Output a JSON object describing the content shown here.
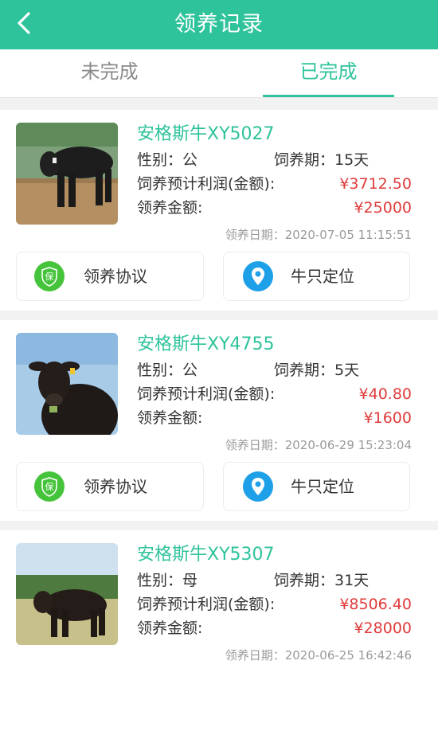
{
  "header": {
    "title": "领养记录"
  },
  "tabs": [
    {
      "label": "未完成",
      "active": false
    },
    {
      "label": "已完成",
      "active": true
    }
  ],
  "labels": {
    "gender": "性别",
    "period": "饲养期",
    "profit": "饲养预计利润(金额):",
    "amount": "领养金额:",
    "date": "领养日期",
    "agreement_button": "领养协议",
    "locate_button": "牛只定位",
    "agreement_icon_text": "保"
  },
  "records": [
    {
      "name": "安格斯牛XY5027",
      "gender_text": "性别：公",
      "period_text": "饲养期：15天",
      "profit": "¥3712.50",
      "amount": "¥25000",
      "date_text": "领养日期：2020-07-05 11:15:51",
      "photo": "cow-photo-1"
    },
    {
      "name": "安格斯牛XY4755",
      "gender_text": "性别：公",
      "period_text": "饲养期：5天",
      "profit": "¥40.80",
      "amount": "¥1600",
      "date_text": "领养日期：2020-06-29 15:23:04",
      "photo": "cow-photo-2"
    },
    {
      "name": "安格斯牛XY5307",
      "gender_text": "性别：母",
      "period_text": "饲养期：31天",
      "profit": "¥8506.40",
      "amount": "¥28000",
      "date_text": "领养日期：2020-06-25 16:42:46",
      "photo": "cow-photo-3"
    }
  ],
  "colors": {
    "accent": "#2ec39b",
    "price": "#e03b3b",
    "agreement_icon": "#45c43b",
    "locate_icon": "#1ea0e8"
  }
}
